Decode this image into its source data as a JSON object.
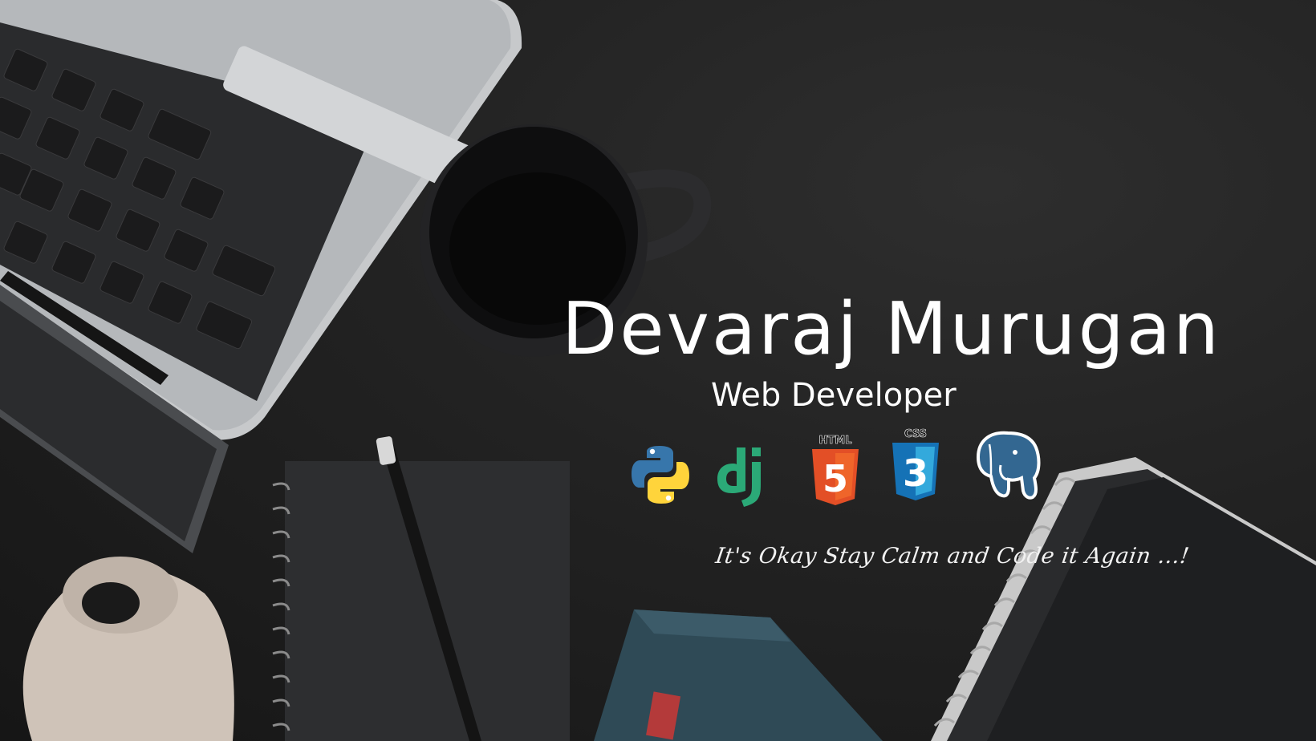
{
  "profile": {
    "name": "Devaraj Murugan",
    "role": "Web Developer",
    "tagline": "It's Okay Stay Calm and Code it Again ...!"
  },
  "tech_icons": [
    {
      "icon": "python-icon",
      "color": "#3776ab"
    },
    {
      "icon": "django-icon",
      "color": "#2ba977"
    },
    {
      "icon": "html5-icon",
      "label": "HTML",
      "glyph": "5",
      "color": "#e34f26"
    },
    {
      "icon": "css3-icon",
      "label": "CSS",
      "glyph": "3",
      "color": "#1572b6"
    },
    {
      "icon": "postgresql-icon",
      "color": "#336791"
    }
  ]
}
